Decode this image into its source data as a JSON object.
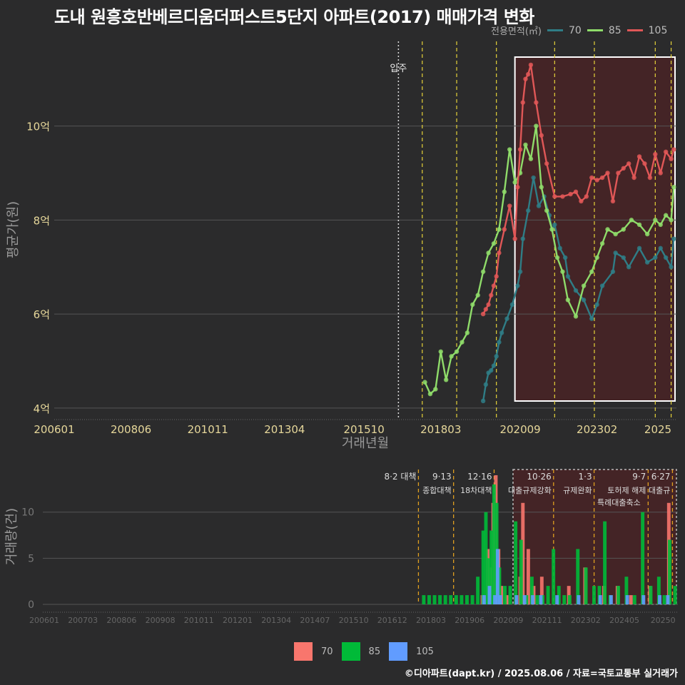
{
  "title": "도내 원흥호반베르디움더퍼스트5단지 아파트(2017) 매매가격 변화",
  "legend_top": {
    "label": "전용면적(㎡)",
    "items": [
      {
        "name": "70",
        "color": "#2f7d86"
      },
      {
        "name": "85",
        "color": "#8fdc6a"
      },
      {
        "name": "105",
        "color": "#e05757"
      }
    ]
  },
  "legend_bottom": {
    "items": [
      {
        "name": "70",
        "color": "#f8766d"
      },
      {
        "name": "85",
        "color": "#00ba38"
      },
      {
        "name": "105",
        "color": "#619cff"
      }
    ]
  },
  "footer": "©디아파트(dapt.kr) / 2025.08.06 / 자료=국토교통부 실거래가",
  "chart_data": [
    {
      "type": "line",
      "ylabel": "평균가(원)",
      "xlabel": "거래년월",
      "y_unit": "억",
      "ylim": [
        3.8,
        11.8
      ],
      "y_ticks": [
        4,
        6,
        8,
        10
      ],
      "y_tick_labels": [
        "4억",
        "6억",
        "8억",
        "10억"
      ],
      "x_ticks": [
        "200601",
        "200806",
        "201011",
        "201304",
        "201510",
        "201803",
        "202009",
        "202302",
        "2025"
      ],
      "x_range": [
        "2006-01",
        "2025-08"
      ],
      "annotations": [
        {
          "x": "2016-11",
          "label": "입주"
        }
      ],
      "policy_lines": [
        "2017-08",
        "2018-09",
        "2019-12",
        "2021-10",
        "2023-01",
        "2024-12",
        "2025-06"
      ],
      "highlight_range": [
        "2020-07",
        "2025-08"
      ],
      "series": [
        {
          "name": "70",
          "x": [
            "2019-07",
            "2019-08",
            "2019-09",
            "2019-10",
            "2019-11",
            "2019-12",
            "2020-01",
            "2020-02",
            "2020-04",
            "2020-06",
            "2020-08",
            "2020-09",
            "2020-10",
            "2020-12",
            "2021-02",
            "2021-04",
            "2021-06",
            "2021-08",
            "2021-09",
            "2021-10",
            "2021-12",
            "2022-02",
            "2022-03",
            "2022-06",
            "2022-09",
            "2022-12",
            "2023-02",
            "2023-04",
            "2023-08",
            "2023-09",
            "2023-12",
            "2024-02",
            "2024-06",
            "2024-09",
            "2024-12",
            "2025-02",
            "2025-04",
            "2025-06",
            "2025-07"
          ],
          "values": [
            4.15,
            4.5,
            4.75,
            4.8,
            4.9,
            5.1,
            5.4,
            5.6,
            5.9,
            6.2,
            6.6,
            6.9,
            7.6,
            8.2,
            8.9,
            8.3,
            8.5,
            8.1,
            7.8,
            7.9,
            7.4,
            7.2,
            6.8,
            6.5,
            6.3,
            5.9,
            6.2,
            6.6,
            6.9,
            7.3,
            7.2,
            7.0,
            7.4,
            7.1,
            7.2,
            7.4,
            7.2,
            7.0,
            7.6
          ]
        },
        {
          "name": "85",
          "x": [
            "2017-09",
            "2017-11",
            "2018-01",
            "2018-03",
            "2018-05",
            "2018-07",
            "2018-09",
            "2018-11",
            "2019-01",
            "2019-03",
            "2019-05",
            "2019-07",
            "2019-09",
            "2019-11",
            "2020-01",
            "2020-03",
            "2020-05",
            "2020-07",
            "2020-09",
            "2020-11",
            "2021-01",
            "2021-03",
            "2021-05",
            "2021-07",
            "2021-09",
            "2021-11",
            "2022-01",
            "2022-03",
            "2022-06",
            "2022-09",
            "2022-12",
            "2023-02",
            "2023-04",
            "2023-06",
            "2023-09",
            "2023-12",
            "2024-03",
            "2024-06",
            "2024-09",
            "2024-12",
            "2025-02",
            "2025-04",
            "2025-06",
            "2025-07"
          ],
          "values": [
            4.55,
            4.3,
            4.4,
            5.2,
            4.6,
            5.1,
            5.2,
            5.4,
            5.6,
            6.2,
            6.4,
            6.9,
            7.3,
            7.5,
            7.8,
            8.6,
            9.5,
            8.8,
            9.0,
            9.6,
            9.3,
            10.0,
            8.7,
            8.2,
            7.8,
            7.2,
            6.9,
            6.3,
            5.95,
            6.6,
            6.9,
            7.2,
            7.5,
            7.8,
            7.7,
            7.8,
            8.0,
            7.9,
            7.7,
            8.0,
            7.9,
            8.1,
            8.0,
            8.7
          ]
        },
        {
          "name": "105",
          "x": [
            "2019-07",
            "2019-08",
            "2019-09",
            "2019-10",
            "2019-11",
            "2019-12",
            "2020-01",
            "2020-03",
            "2020-05",
            "2020-07",
            "2020-08",
            "2020-09",
            "2020-10",
            "2020-11",
            "2020-12",
            "2021-01",
            "2021-03",
            "2021-05",
            "2021-07",
            "2021-10",
            "2022-01",
            "2022-04",
            "2022-06",
            "2022-08",
            "2022-10",
            "2022-12",
            "2023-02",
            "2023-04",
            "2023-06",
            "2023-08",
            "2023-10",
            "2023-12",
            "2024-02",
            "2024-04",
            "2024-06",
            "2024-08",
            "2024-10",
            "2024-12",
            "2025-02",
            "2025-04",
            "2025-06",
            "2025-07"
          ],
          "values": [
            6.0,
            6.1,
            6.2,
            6.4,
            6.6,
            6.8,
            7.3,
            7.8,
            8.3,
            7.6,
            8.7,
            9.5,
            10.5,
            11.0,
            11.1,
            11.3,
            10.5,
            9.8,
            9.2,
            8.5,
            8.5,
            8.55,
            8.6,
            8.4,
            8.5,
            8.9,
            8.85,
            8.9,
            9.0,
            8.4,
            9.0,
            9.1,
            9.2,
            8.9,
            9.35,
            9.2,
            8.9,
            9.4,
            9.0,
            9.45,
            9.3,
            9.5
          ]
        }
      ]
    },
    {
      "type": "bar",
      "ylabel": "거래량(건)",
      "ylim": [
        0,
        14
      ],
      "y_ticks": [
        0,
        5,
        10
      ],
      "y_tick_labels": [
        "0",
        "5",
        "10"
      ],
      "x_ticks": [
        "200601",
        "200703",
        "200806",
        "200908",
        "201011",
        "201201",
        "201304",
        "201407",
        "201510",
        "201612",
        "201803",
        "201906",
        "202009",
        "202111",
        "202302",
        "202405",
        "20250"
      ],
      "policy_annotations": [
        {
          "x": "2017-08",
          "label": "8·2 대책"
        },
        {
          "x": "2018-09",
          "label": "9·13",
          "sub": "종합대책"
        },
        {
          "x": "2019-12",
          "label": "12·16",
          "sub": "18차대책"
        },
        {
          "x": "2021-10",
          "label": "10·26",
          "sub": "대출규제강화"
        },
        {
          "x": "2023-01",
          "label": "1·3",
          "sub": "규제완화"
        },
        {
          "x": "2024-07",
          "sub": "특례대출축소"
        },
        {
          "x": "2024-09",
          "label": "9·7",
          "sub": "토허제 해제"
        },
        {
          "x": "2025-06",
          "label": "6·27",
          "sub": "대출규"
        }
      ],
      "highlight_range": [
        "2020-07",
        "2025-08"
      ],
      "series": [
        {
          "name": "70",
          "months": [
            "2019-07",
            "2019-09",
            "2019-10",
            "2019-11",
            "2019-12",
            "2020-01",
            "2020-02",
            "2020-04",
            "2020-09",
            "2020-10",
            "2020-12",
            "2021-02",
            "2021-05",
            "2022-03",
            "2022-09",
            "2023-04",
            "2023-09",
            "2024-02",
            "2024-09",
            "2025-04"
          ],
          "values": [
            1,
            6,
            4,
            11,
            14,
            6,
            2,
            1,
            3,
            11,
            6,
            2,
            3,
            2,
            4,
            2,
            2,
            1,
            2,
            11
          ]
        },
        {
          "name": "85",
          "months": [
            "2017-09",
            "2017-11",
            "2018-01",
            "2018-03",
            "2018-05",
            "2018-07",
            "2018-09",
            "2018-11",
            "2019-01",
            "2019-03",
            "2019-05",
            "2019-07",
            "2019-08",
            "2019-09",
            "2019-10",
            "2019-11",
            "2019-12",
            "2020-01",
            "2020-03",
            "2020-05",
            "2020-07",
            "2020-09",
            "2020-11",
            "2021-01",
            "2021-03",
            "2021-05",
            "2021-07",
            "2021-09",
            "2021-11",
            "2022-01",
            "2022-03",
            "2022-06",
            "2022-09",
            "2022-12",
            "2023-02",
            "2023-04",
            "2023-06",
            "2023-09",
            "2023-12",
            "2024-03",
            "2024-06",
            "2024-09",
            "2024-12",
            "2025-02",
            "2025-04",
            "2025-06"
          ],
          "values": [
            1,
            1,
            1,
            1,
            1,
            1,
            1,
            1,
            1,
            1,
            3,
            8,
            10,
            5,
            8,
            13,
            11,
            4,
            2,
            2,
            9,
            7,
            1,
            3,
            1,
            1,
            2,
            6,
            2,
            1,
            1,
            6,
            4,
            2,
            2,
            9,
            1,
            2,
            3,
            1,
            10,
            2,
            3,
            1,
            7,
            2
          ]
        },
        {
          "name": "105",
          "months": [
            "2019-07",
            "2019-09",
            "2019-11",
            "2019-12",
            "2020-01",
            "2020-07",
            "2020-10",
            "2021-01",
            "2021-04",
            "2021-10",
            "2022-06",
            "2023-02",
            "2023-06",
            "2023-12",
            "2024-06",
            "2024-12",
            "2025-03"
          ],
          "values": [
            1,
            2,
            1,
            6,
            1,
            1,
            1,
            1,
            1,
            1,
            1,
            1,
            1,
            1,
            1,
            1,
            1
          ]
        }
      ]
    }
  ]
}
